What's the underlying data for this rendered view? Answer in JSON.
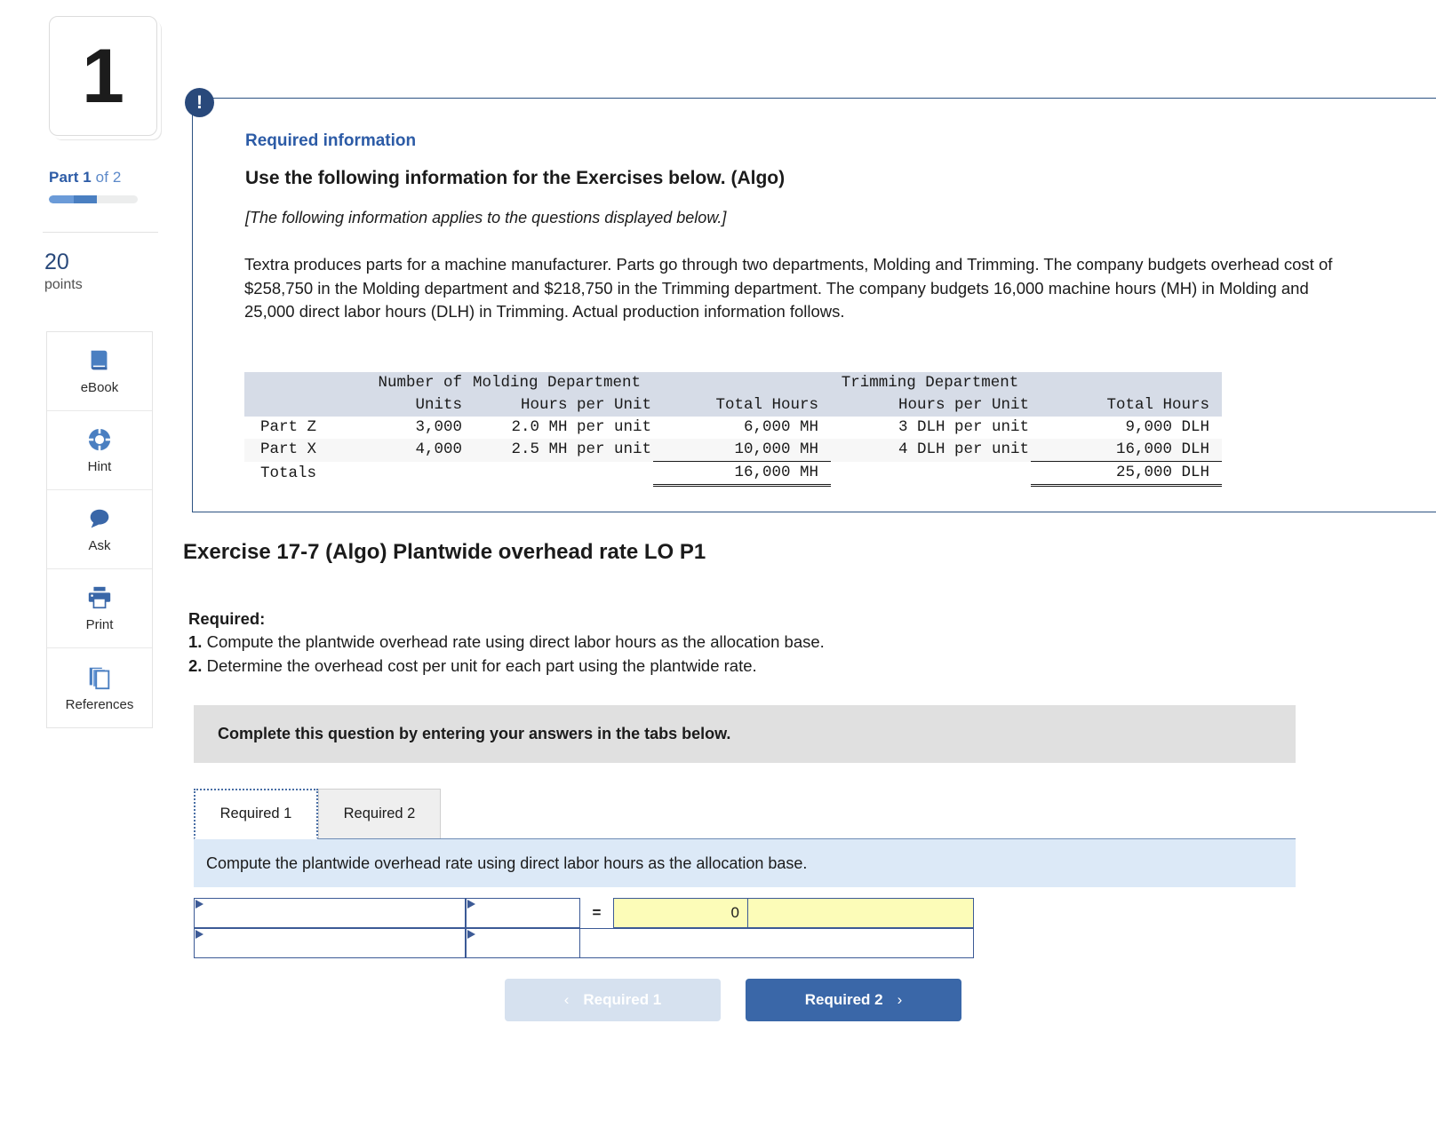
{
  "sidebar": {
    "question_number": "1",
    "part_label_prefix": "Part 1",
    "part_label_suffix": " of 2",
    "points_value": "20",
    "points_label": "points",
    "tools": [
      {
        "name": "ebook",
        "label": "eBook"
      },
      {
        "name": "hint",
        "label": "Hint"
      },
      {
        "name": "ask",
        "label": "Ask"
      },
      {
        "name": "print",
        "label": "Print"
      },
      {
        "name": "references",
        "label": "References"
      }
    ]
  },
  "required_info": {
    "badge": "!",
    "heading": "Required information",
    "title": "Use the following information for the Exercises below. (Algo)",
    "subtitle": "[The following information applies to the questions displayed below.]",
    "body": "Textra produces parts for a machine manufacturer. Parts go through two departments, Molding and Trimming. The company budgets overhead cost of $258,750 in the Molding department and $218,750 in the Trimming department. The company budgets 16,000 machine hours (MH) in Molding and 25,000 direct labor hours (DLH) in Trimming. Actual production information follows."
  },
  "data_table": {
    "group_headers": {
      "molding": "Molding Department",
      "trimming": "Trimming Department"
    },
    "column_headers": {
      "blank": "",
      "units_line1": "Number of",
      "units_line2": "Units",
      "molding_hpu": "Hours per Unit",
      "molding_total": "Total Hours",
      "trimming_hpu": "Hours per Unit",
      "trimming_total": "Total Hours"
    },
    "rows": [
      {
        "label": "Part Z",
        "units": "3,000",
        "molding_hpu": "2.0 MH per unit",
        "molding_total": "6,000 MH",
        "trimming_hpu": "3 DLH per unit",
        "trimming_total": "9,000 DLH"
      },
      {
        "label": "Part X",
        "units": "4,000",
        "molding_hpu": "2.5 MH per unit",
        "molding_total": "10,000 MH",
        "trimming_hpu": "4 DLH per unit",
        "trimming_total": "16,000 DLH"
      }
    ],
    "totals": {
      "label": "Totals",
      "units": "",
      "molding_hpu": "",
      "molding_total": "16,000 MH",
      "trimming_hpu": "",
      "trimming_total": "25,000 DLH"
    }
  },
  "exercise": {
    "title": "Exercise 17-7 (Algo) Plantwide overhead rate LO P1",
    "required_label": "Required:",
    "req1_num": "1.",
    "req1_text": " Compute the plantwide overhead rate using direct labor hours as the allocation base.",
    "req2_num": "2.",
    "req2_text": " Determine the overhead cost per unit for each part using the plantwide rate."
  },
  "answer_widget": {
    "banner": "Complete this question by entering your answers in the tabs below.",
    "tabs": [
      {
        "label": "Required 1",
        "active": true
      },
      {
        "label": "Required 2",
        "active": false
      }
    ],
    "prompt": "Compute the plantwide overhead rate using direct labor hours as the allocation base.",
    "grid": {
      "row1": {
        "cell_a": "",
        "cell_b": "",
        "equals": "=",
        "result": "0",
        "result_unit": ""
      },
      "row2": {
        "cell_a": "",
        "cell_b": ""
      }
    },
    "nav": {
      "prev_label": "Required 1",
      "prev_chevron": "‹",
      "next_label": "Required 2",
      "next_chevron": "›"
    }
  },
  "colors": {
    "accent_blue": "#2c5ba6",
    "navy": "#29497b",
    "table_header_bg": "#d6dce7",
    "prompt_bg": "#dce9f7",
    "banner_bg": "#e0e0e0",
    "input_yellow": "#fcfcb8",
    "button_blue": "#3a67a8"
  }
}
